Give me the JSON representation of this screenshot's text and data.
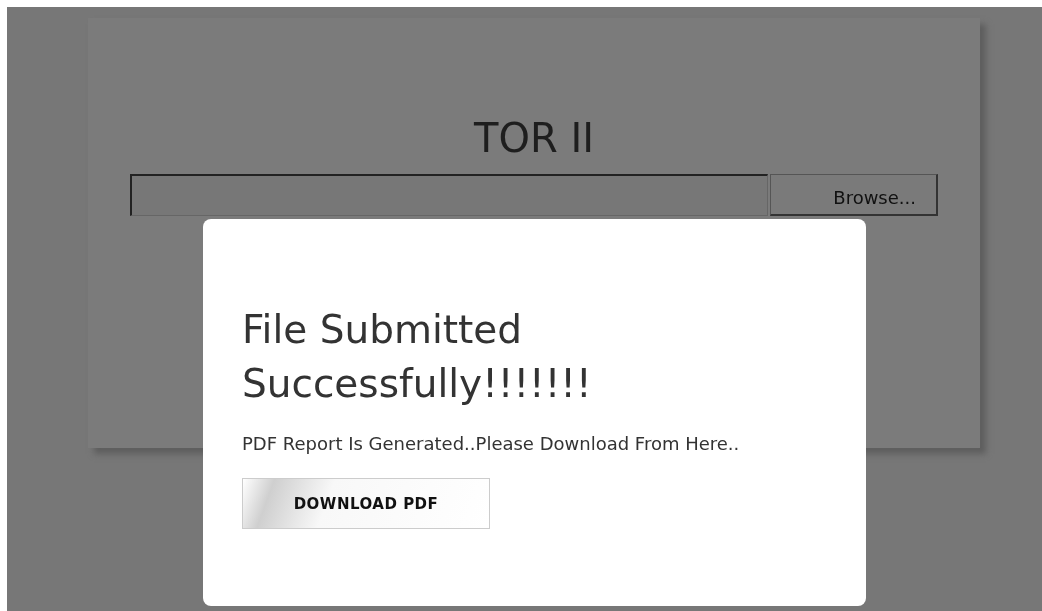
{
  "page": {
    "title": "TOR II",
    "browse_button": "Browse..."
  },
  "dialog": {
    "heading": "File Submitted Successfully!!!!!!!",
    "message": "PDF Report Is Generated..Please Download From Here..",
    "button": "DOWNLOAD PDF"
  }
}
